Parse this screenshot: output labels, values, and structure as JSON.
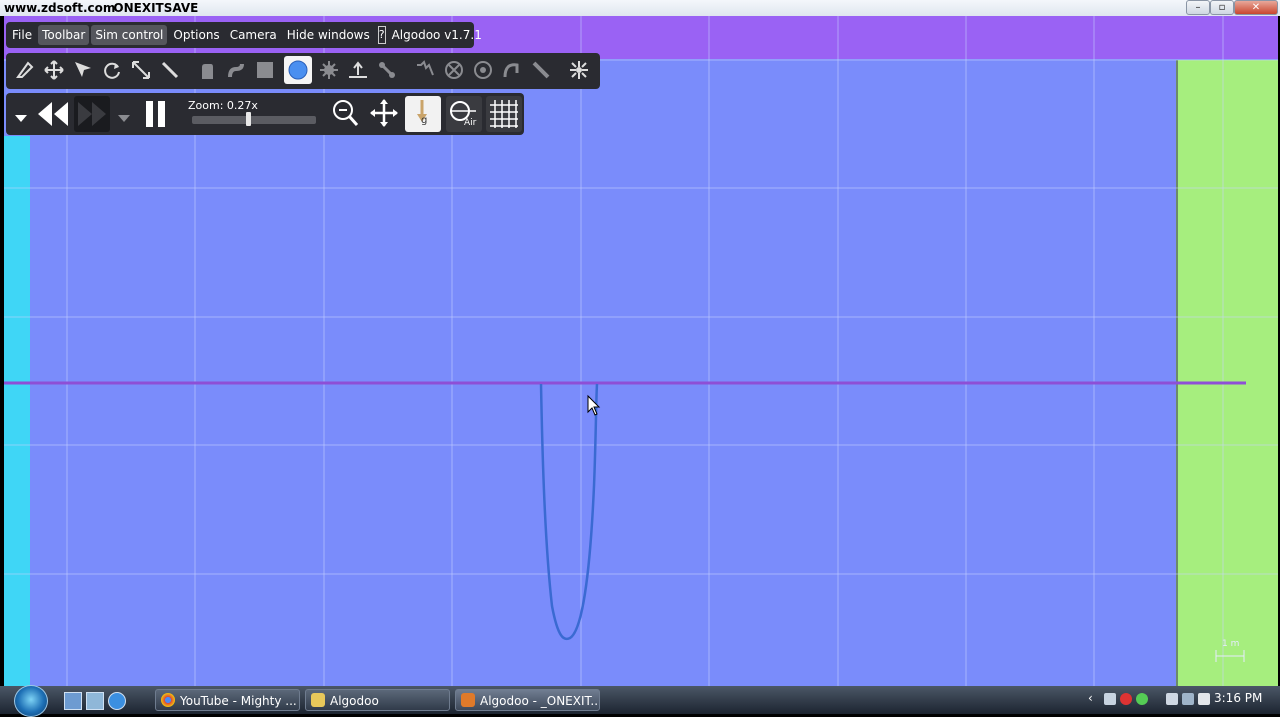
{
  "watermark": "www.zdsoft.com",
  "window_title": "ONEXITSAVE",
  "window_controls": {
    "minimize": "–",
    "maximize": "▫",
    "close": "✕"
  },
  "menubar": {
    "items": [
      "File",
      "Toolbar",
      "Sim control",
      "Options",
      "Camera",
      "Hide windows"
    ],
    "help": "?",
    "version": "Algodoo v1.7.1"
  },
  "toolbar": {
    "tools": [
      "sketch-tool",
      "move-tool",
      "drag-tool",
      "rotate-tool",
      "scale-tool",
      "knife-tool",
      "hand-tool",
      "rope-tool",
      "box-tool",
      "circle-tool",
      "gear-tool",
      "plane-tool",
      "chain-tool",
      "spring-tool",
      "fixate-tool",
      "axle-tool",
      "tracer-tool",
      "thruster-tool",
      "laser-tool"
    ],
    "selected": "circle-tool"
  },
  "simcontrol": {
    "zoom_label": "Zoom: 0.27x",
    "zoom_fraction": 0.45,
    "gravity_label": "g",
    "air_label": "Air"
  },
  "scale_label": "1 m",
  "colors": {
    "canvas": "#7a8cfb",
    "top_strip": "#9a62f4",
    "left_strip": "#3fd6f6",
    "right_strip": "#a6ee7e",
    "plane_line": "#8e4fd6",
    "tracer": "#3a6ad2"
  },
  "taskbar": {
    "tasks": [
      {
        "label": "YouTube - Mighty ...",
        "icon": "chrome-icon"
      },
      {
        "label": "Algodoo",
        "icon": "folder-icon"
      },
      {
        "label": "Algodoo - _ONEXIT...",
        "icon": "algodoo-icon"
      }
    ],
    "clock": "3:16 PM"
  }
}
